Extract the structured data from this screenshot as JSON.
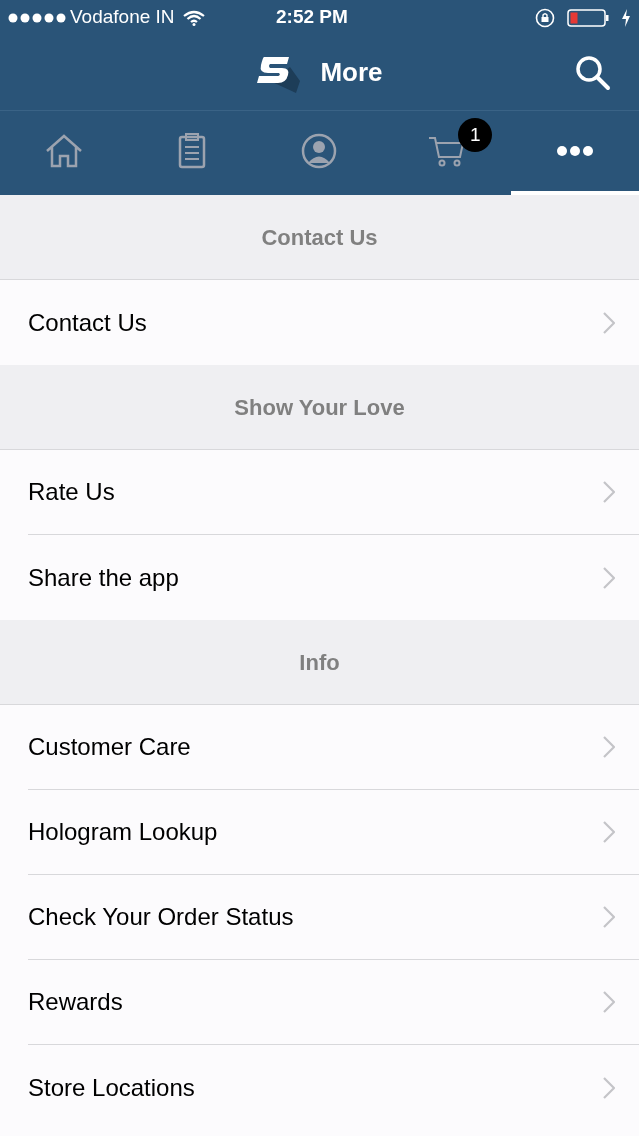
{
  "status_bar": {
    "carrier": "Vodafone IN",
    "time": "2:52 PM"
  },
  "header": {
    "title": "More"
  },
  "tabs": [
    {
      "kind": "home",
      "selected": false
    },
    {
      "kind": "orders",
      "selected": false
    },
    {
      "kind": "account",
      "selected": false
    },
    {
      "kind": "cart",
      "selected": false,
      "badge": "1"
    },
    {
      "kind": "more",
      "selected": true
    }
  ],
  "sections": [
    {
      "title": "Contact Us",
      "items": [
        "Contact Us"
      ]
    },
    {
      "title": "Show Your Love",
      "items": [
        "Rate Us",
        "Share the app"
      ]
    },
    {
      "title": "Info",
      "items": [
        "Customer Care",
        "Hologram Lookup",
        "Check Your Order Status",
        "Rewards",
        "Store Locations"
      ]
    }
  ]
}
